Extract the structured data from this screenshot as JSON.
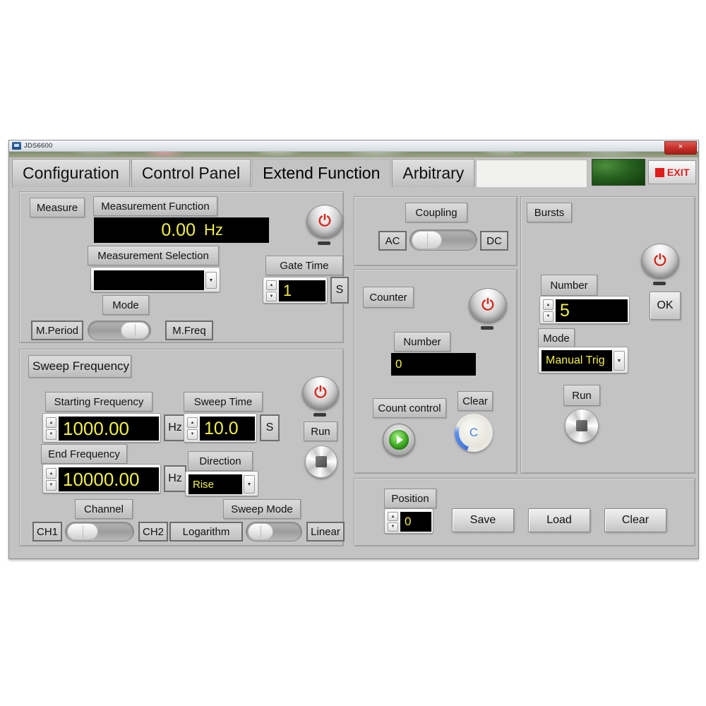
{
  "window": {
    "title": "JDS6600",
    "close_label": "×"
  },
  "tabs": [
    {
      "label": "Configuration",
      "active": false
    },
    {
      "label": "Control Panel",
      "active": false
    },
    {
      "label": "Extend Function",
      "active": true
    },
    {
      "label": "Arbitrary",
      "active": false
    }
  ],
  "header": {
    "exit_label": "EXIT",
    "led_color": "#2b6a22",
    "exit_color": "#e21b1b"
  },
  "measure": {
    "title": "Measure",
    "function_label": "Measurement Function",
    "function_value": "0.00",
    "function_unit": "Hz",
    "selection_label": "Measurement Selection",
    "selection_value": "",
    "mode_label": "Mode",
    "mode_left": "M.Period",
    "mode_right": "M.Freq",
    "mode_position": "right",
    "gate_time_label": "Gate Time",
    "gate_time_value": "1",
    "gate_time_unit": "S",
    "power_icon": "power-icon"
  },
  "sweep": {
    "title": "Sweep Frequency",
    "starting_label": "Starting Frequency",
    "starting_value": "1000.00",
    "starting_unit": "Hz",
    "end_label": "End Frequency",
    "end_value": "10000.00",
    "end_unit": "Hz",
    "sweep_time_label": "Sweep Time",
    "sweep_time_value": "10.0",
    "sweep_time_unit": "S",
    "direction_label": "Direction",
    "direction_value": "Rise",
    "channel_label": "Channel",
    "channel_left": "CH1",
    "channel_right": "CH2",
    "channel_position": "left",
    "sweep_mode_label": "Sweep Mode",
    "sweep_mode_left": "Logarithm",
    "sweep_mode_right": "Linear",
    "sweep_mode_position": "left",
    "run_label": "Run"
  },
  "coupling": {
    "title": "Coupling",
    "left": "AC",
    "right": "DC",
    "position": "left"
  },
  "counter": {
    "title": "Counter",
    "number_label": "Number",
    "number_value": "0",
    "count_control_label": "Count control",
    "clear_label": "Clear",
    "play_icon": "play-icon",
    "refresh_icon": "refresh-icon",
    "refresh_glyph": "C"
  },
  "bursts": {
    "title": "Bursts",
    "number_label": "Number",
    "number_value": "5",
    "mode_label": "Mode",
    "mode_value": "Manual Trig",
    "ok_label": "OK",
    "run_label": "Run"
  },
  "storage": {
    "position_label": "Position",
    "position_value": "0",
    "save_label": "Save",
    "load_label": "Load",
    "clear_label": "Clear"
  },
  "glyphs": {
    "power": "⏻",
    "up": "▲",
    "down": "▼",
    "dropdown": "▼"
  }
}
